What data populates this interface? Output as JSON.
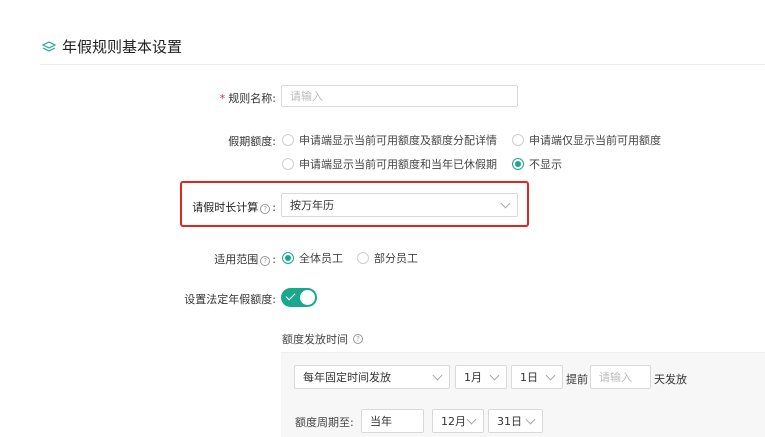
{
  "section": {
    "title": "年假规则基本设置",
    "icon": "layers-icon"
  },
  "rule_name": {
    "required_mark": "*",
    "label": "规则名称:",
    "placeholder": "请输入"
  },
  "quota": {
    "label": "假期额度:",
    "options": [
      {
        "label": "申请端显示当前可用额度及额度分配详情",
        "selected": false
      },
      {
        "label": "申请端仅显示当前可用额度",
        "selected": false
      },
      {
        "label": "申请端显示当前可用额度和当年已休假期",
        "selected": false
      },
      {
        "label": "不显示",
        "selected": true
      }
    ]
  },
  "duration_calc": {
    "label": "请假时长计算",
    "colon": ":",
    "value": "按万年历"
  },
  "scope": {
    "label": "适用范围",
    "colon": ":",
    "options": [
      {
        "label": "全体员工",
        "selected": true
      },
      {
        "label": "部分员工",
        "selected": false
      }
    ]
  },
  "statutory": {
    "label": "设置法定年假额度:",
    "enabled": true
  },
  "grant_time": {
    "label": "额度发放时间"
  },
  "grant_row": {
    "method": "每年固定时间发放",
    "month": "1月",
    "day": "1日",
    "before_text": "提前",
    "days_placeholder": "请输入",
    "after_text": "天发放"
  },
  "period_row": {
    "label": "额度周期至:",
    "year_value": "当年",
    "month": "12月",
    "day": "31日"
  },
  "colors": {
    "accent": "#1aa88c",
    "highlight": "#e0261f",
    "required": "#f5222d"
  }
}
